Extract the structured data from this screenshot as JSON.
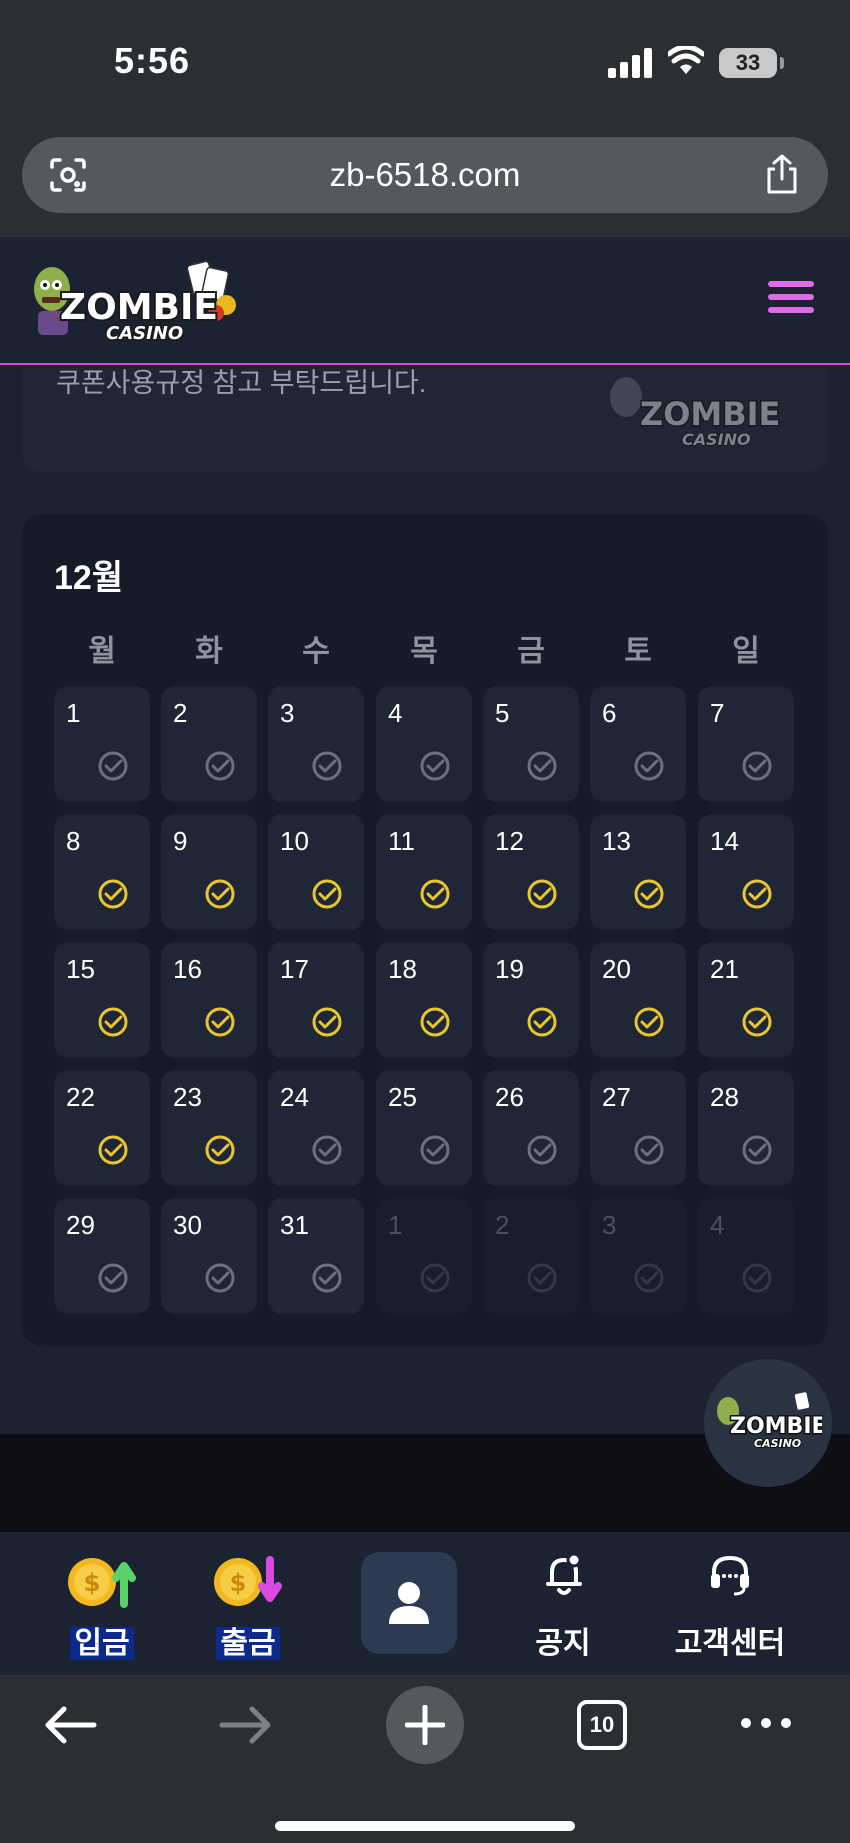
{
  "status": {
    "time": "5:56",
    "battery": "33"
  },
  "browser": {
    "url": "zb-6518.com",
    "tab_count": "10"
  },
  "site": {
    "logo_text": "ZOMBIE CASINO"
  },
  "notice": {
    "text": "쿠폰사용규정 참고 부탁드립니다."
  },
  "calendar": {
    "month": "12월",
    "weekdays": [
      "월",
      "화",
      "수",
      "목",
      "금",
      "토",
      "일"
    ],
    "days": [
      {
        "label": "1",
        "checked": false,
        "current": true
      },
      {
        "label": "2",
        "checked": false,
        "current": true
      },
      {
        "label": "3",
        "checked": false,
        "current": true
      },
      {
        "label": "4",
        "checked": false,
        "current": true
      },
      {
        "label": "5",
        "checked": false,
        "current": true
      },
      {
        "label": "6",
        "checked": false,
        "current": true
      },
      {
        "label": "7",
        "checked": false,
        "current": true
      },
      {
        "label": "8",
        "checked": true,
        "current": true
      },
      {
        "label": "9",
        "checked": true,
        "current": true
      },
      {
        "label": "10",
        "checked": true,
        "current": true
      },
      {
        "label": "11",
        "checked": true,
        "current": true
      },
      {
        "label": "12",
        "checked": true,
        "current": true
      },
      {
        "label": "13",
        "checked": true,
        "current": true
      },
      {
        "label": "14",
        "checked": true,
        "current": true
      },
      {
        "label": "15",
        "checked": true,
        "current": true
      },
      {
        "label": "16",
        "checked": true,
        "current": true
      },
      {
        "label": "17",
        "checked": true,
        "current": true
      },
      {
        "label": "18",
        "checked": true,
        "current": true
      },
      {
        "label": "19",
        "checked": true,
        "current": true
      },
      {
        "label": "20",
        "checked": true,
        "current": true
      },
      {
        "label": "21",
        "checked": true,
        "current": true
      },
      {
        "label": "22",
        "checked": true,
        "current": true
      },
      {
        "label": "23",
        "checked": true,
        "current": true
      },
      {
        "label": "24",
        "checked": false,
        "current": true
      },
      {
        "label": "25",
        "checked": false,
        "current": true
      },
      {
        "label": "26",
        "checked": false,
        "current": true
      },
      {
        "label": "27",
        "checked": false,
        "current": true
      },
      {
        "label": "28",
        "checked": false,
        "current": true
      },
      {
        "label": "29",
        "checked": false,
        "current": true
      },
      {
        "label": "30",
        "checked": false,
        "current": true
      },
      {
        "label": "31",
        "checked": false,
        "current": true
      },
      {
        "label": "1",
        "checked": false,
        "current": false
      },
      {
        "label": "2",
        "checked": false,
        "current": false
      },
      {
        "label": "3",
        "checked": false,
        "current": false
      },
      {
        "label": "4",
        "checked": false,
        "current": false
      }
    ]
  },
  "bottom_nav": {
    "deposit": "입금",
    "withdraw": "출금",
    "notice": "공지",
    "support": "고객센터"
  },
  "colors": {
    "accent": "#e06ae8",
    "check_active": "#e8c630",
    "check_inactive": "#6b7180",
    "highlight_label": "#0c2a8c"
  },
  "icons": [
    "lens-icon",
    "share-icon",
    "menu-icon",
    "check-icon",
    "coin-up-icon",
    "coin-down-icon",
    "user-icon",
    "bell-icon",
    "headset-icon",
    "back-icon",
    "forward-icon",
    "plus-icon",
    "tabs-icon",
    "more-icon"
  ]
}
